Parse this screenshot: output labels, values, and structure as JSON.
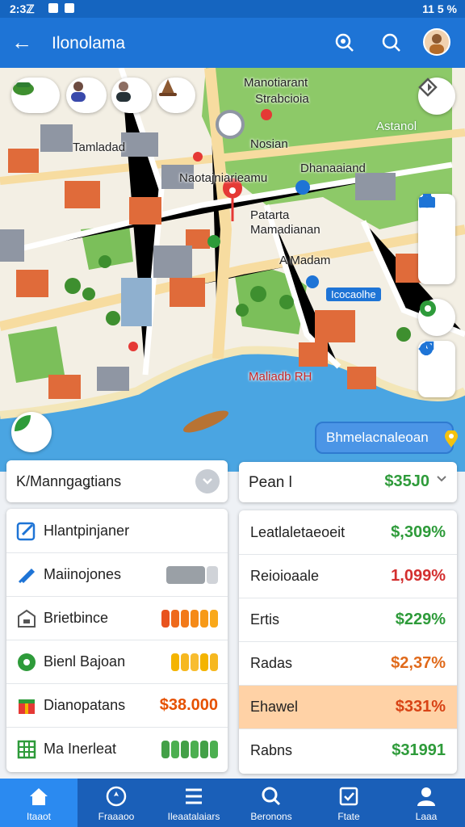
{
  "status_bar": {
    "time": "2:3ℤ",
    "right": "11 5 %"
  },
  "app_bar": {
    "title": "Ilonolama"
  },
  "map": {
    "labels": [
      "Manotiarant",
      "Strabcioia",
      "Astanol",
      "Tamladad",
      "Nosian",
      "Dhanaaiand",
      "Naotajniarieamu",
      "Patarta",
      "Mamadianan",
      "A Madam",
      "Maliadb RH",
      "Icocaolhe"
    ],
    "banner": "Bhmelacnaleoan",
    "pin_color": "#e53935"
  },
  "left_panel": {
    "dropdown_label": "K/Manngaǥtians",
    "items": [
      {
        "label": "Hlantpinjaner",
        "icon": "edit-icon"
      },
      {
        "label": "Maiinojones",
        "icon": "pencil-icon"
      },
      {
        "label": "Brietbince",
        "icon": "store-icon"
      },
      {
        "label": "Bienl Bajoan",
        "icon": "leaf-icon"
      },
      {
        "label": "Dianopatans",
        "icon": "gift-icon",
        "value": "$38.000"
      },
      {
        "label": "Ma Inerleat",
        "icon": "grid-icon"
      }
    ]
  },
  "right_panel": {
    "header_label": "Pean l",
    "header_value": "$35J0",
    "rows": [
      {
        "label": "Leatlaletaeoeit",
        "value": "$,309%",
        "color": "#2e9b3a"
      },
      {
        "label": "Reioioaale",
        "value": "1,099%",
        "color": "#d32f2f"
      },
      {
        "label": "Ertis",
        "value": "$229%",
        "color": "#2e9b3a"
      },
      {
        "label": "Radas",
        "value": "$2,37%",
        "color": "#e06a1b"
      },
      {
        "label": "Ehawel",
        "value": "$331%",
        "color": "#d84315",
        "highlight": "#ffd2a6"
      },
      {
        "label": "Rabns",
        "value": "$31991",
        "color": "#2e9b3a"
      }
    ]
  },
  "bottom_nav": [
    {
      "label": "Itaaot",
      "icon": "home-icon",
      "active": true
    },
    {
      "label": "Fraaaoo",
      "icon": "compass-icon"
    },
    {
      "label": "Ileaatalaiars",
      "icon": "menu-icon"
    },
    {
      "label": "Beronons",
      "icon": "search-icon"
    },
    {
      "label": "Ftate",
      "icon": "check-icon"
    },
    {
      "label": "Laaa",
      "icon": "person-icon"
    }
  ],
  "colors": {
    "primary": "#1e74d6",
    "nav": "#1a5fb8",
    "nav_active": "#2b8af0",
    "green": "#2e9b3a",
    "red": "#d32f2f"
  }
}
